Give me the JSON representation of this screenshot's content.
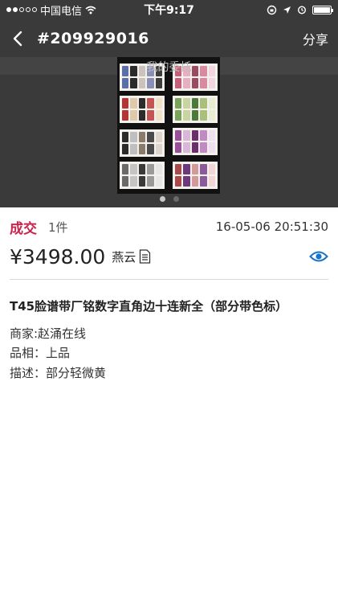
{
  "status_bar": {
    "carrier": "中国电信",
    "time": "下午9:17"
  },
  "nav": {
    "title": "#209929016",
    "share_label": "分享"
  },
  "gallery": {
    "caption": "我的委托",
    "page_count": 2,
    "current_page": 1
  },
  "order": {
    "status": "成交",
    "quantity": "1件",
    "datetime": "16-05-06 20:51:30",
    "price": "¥3498.00",
    "buyer": "燕云"
  },
  "item": {
    "title": "T45脸谱带厂铭数字直角边十连新全（部分带色标）",
    "merchant": "商家:赵涌在线",
    "condition": "品相：上品",
    "description": "描述：部分轻微黄"
  },
  "colors": {
    "status_red": "#c7254e",
    "eye_blue": "#1a73c9",
    "bar_dark": "#3a3a3a"
  },
  "icons": {
    "back": "chevron-left-icon",
    "document": "document-icon",
    "watch": "eye-icon"
  }
}
